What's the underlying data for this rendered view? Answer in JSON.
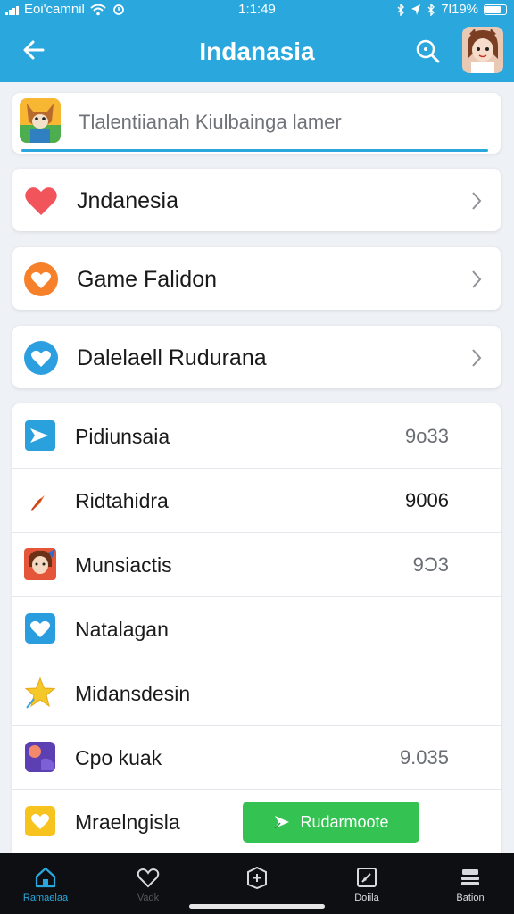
{
  "status_bar": {
    "carrier": "Eoi'camnil",
    "time": "1:1:49",
    "battery_text": "7l19%"
  },
  "app_bar": {
    "title": "Indanasia",
    "back_icon": "back-arrow-icon",
    "search_icon": "search-icon",
    "avatar_icon": "avatar"
  },
  "search": {
    "placeholder": "Tlalentiianah Kiulbainga lamer"
  },
  "nav_items": [
    {
      "label": "Jndanesia",
      "icon": "heart-icon",
      "color": "#f2545b"
    },
    {
      "label": "Game Falidon",
      "icon": "orange-heart-icon",
      "color": "#f7812a"
    },
    {
      "label": "Dalelaell Rudurana",
      "icon": "blue-heart-icon",
      "color": "#2b9fe0"
    }
  ],
  "list_items": [
    {
      "label": "Pidiunsaia",
      "value": "9o33",
      "icon": "play-arrow-icon"
    },
    {
      "label": "Ridtahidra",
      "value": "9006",
      "icon": "rocket-icon"
    },
    {
      "label": "Munsiactis",
      "value": "9Ɔ3",
      "icon": "character-icon"
    },
    {
      "label": "Natalagan",
      "value": "",
      "icon": "heart-badge-icon"
    },
    {
      "label": "Midansdesin",
      "value": "",
      "icon": "star-icon"
    },
    {
      "label": "Cpo kuak",
      "value": "9.035",
      "icon": "purple-app-icon"
    },
    {
      "label": "Mraelngisla",
      "value": "",
      "icon": "yellow-heart-icon"
    }
  ],
  "action_button": {
    "label": "Rudarmoote",
    "icon": "send-icon"
  },
  "tabs": [
    {
      "label": "Ramaelaa",
      "icon": "home-icon"
    },
    {
      "label": "Vadk",
      "icon": "heart-outline-icon"
    },
    {
      "label": "",
      "icon": "plus-square-icon"
    },
    {
      "label": "Doiila",
      "icon": "edit-square-icon"
    },
    {
      "label": "Bation",
      "icon": "stack-icon"
    }
  ],
  "colors": {
    "accent": "#2aa7dc",
    "action_green": "#34c353",
    "bottom_bar": "#0d0f12"
  }
}
